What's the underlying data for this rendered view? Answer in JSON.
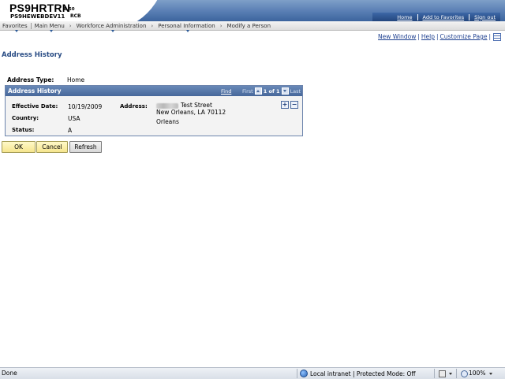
{
  "header": {
    "system": "PS9HRTRN",
    "version": "8.50",
    "database": "PS9HEWEBDEV11",
    "user": "RCB",
    "links": [
      "Home",
      "Add to Favorites",
      "Sign out"
    ]
  },
  "menubar": {
    "favorites": "Favorites",
    "main_menu": "Main Menu",
    "crumbs": [
      "Workforce Administration",
      "Personal Information",
      "Modify a Person"
    ]
  },
  "page_links": {
    "new_window": "New Window",
    "help": "Help",
    "customize": "Customize Page"
  },
  "page_title": "Address History",
  "address_type": {
    "label": "Address Type:",
    "value": "Home"
  },
  "grid": {
    "title": "Address History",
    "find": "Find",
    "first": "First",
    "count": "1 of 1",
    "last": "Last",
    "row": {
      "effective_date_label": "Effective Date:",
      "effective_date": "10/19/2009",
      "country_label": "Country:",
      "country": "USA",
      "status_label": "Status:",
      "status": "A",
      "address_label": "Address:",
      "address_line1": "Test Street",
      "address_line2": "New Orleans, LA 70112",
      "address_line3": "Orleans"
    },
    "add_symbol": "+",
    "delete_symbol": "−"
  },
  "buttons": {
    "ok": "OK",
    "cancel": "Cancel",
    "refresh": "Refresh"
  },
  "statusbar": {
    "status": "Done",
    "zone": "Local intranet | Protected Mode: Off",
    "zoom": "100%"
  }
}
